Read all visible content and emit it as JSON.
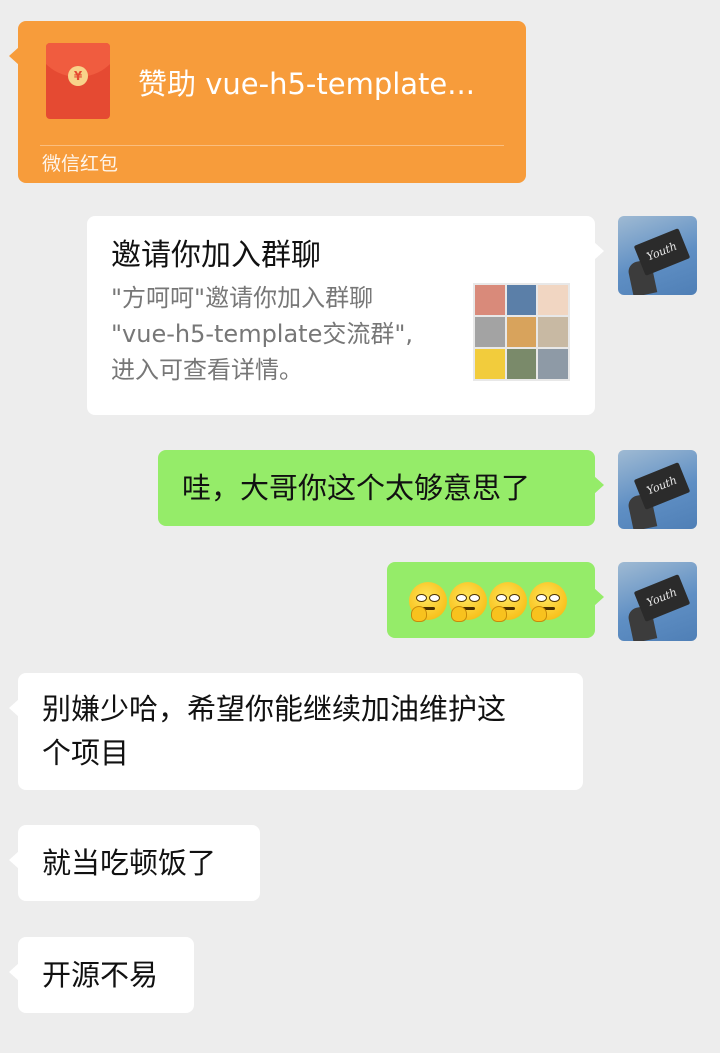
{
  "messages": {
    "red_packet": {
      "title": "赞助 vue-h5-template...",
      "footer": "微信红包",
      "icon": "yuan-coin-icon"
    },
    "invite_card": {
      "title": "邀请你加入群聊",
      "desc_line1": "\"方呵呵\"邀请你加入群聊",
      "desc_line2": "\"vue-h5-template交流群\",",
      "desc_line3": "进入可查看详情。"
    },
    "msg_thanks": "哇，大哥你这个太够意思了",
    "msg_emoji": [
      "thinking-emoji",
      "thinking-emoji",
      "thinking-emoji",
      "thinking-emoji"
    ],
    "msg_encourage_line1": "别嫌少哈，希望你能继续加油维护这",
    "msg_encourage_line2": "个项目",
    "msg_meal": "就当吃顿饭了",
    "msg_hard": "开源不易"
  },
  "avatar_text": "Youth",
  "colors": {
    "background": "#ededed",
    "red_packet": "#f79c3b",
    "green_bubble": "#95ec69",
    "white_bubble": "#ffffff"
  }
}
